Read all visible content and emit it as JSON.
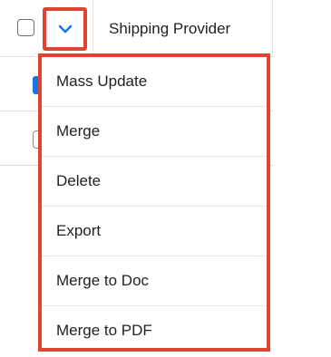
{
  "header": {
    "column_title": "Shipping Provider",
    "toggle_icon": "chevron-down-icon"
  },
  "colors": {
    "highlight": "#e0442c",
    "accent": "#1a73e8"
  },
  "menu": {
    "items": [
      {
        "label": "Mass Update"
      },
      {
        "label": "Merge"
      },
      {
        "label": "Delete"
      },
      {
        "label": "Export"
      },
      {
        "label": "Merge to Doc"
      },
      {
        "label": "Merge to PDF"
      }
    ]
  }
}
